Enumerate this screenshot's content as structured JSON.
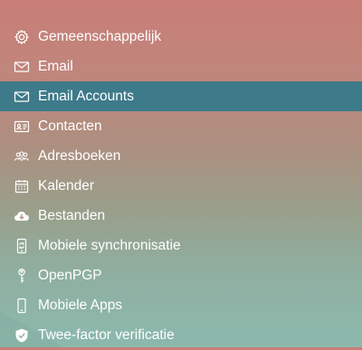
{
  "sidebar": {
    "active_index": 2,
    "items": [
      {
        "label": "Gemeenschappelijk",
        "icon": "gear-icon"
      },
      {
        "label": "Email",
        "icon": "envelope-icon"
      },
      {
        "label": "Email Accounts",
        "icon": "envelope-icon"
      },
      {
        "label": "Contacten",
        "icon": "contact-card-icon"
      },
      {
        "label": "Adresboeken",
        "icon": "people-icon"
      },
      {
        "label": "Kalender",
        "icon": "calendar-icon"
      },
      {
        "label": "Bestanden",
        "icon": "cloud-download-icon"
      },
      {
        "label": "Mobiele synchronisatie",
        "icon": "mobile-sync-icon"
      },
      {
        "label": "OpenPGP",
        "icon": "key-icon"
      },
      {
        "label": "Mobiele Apps",
        "icon": "mobile-phone-icon"
      },
      {
        "label": "Twee-factor verificatie",
        "icon": "shield-icon"
      }
    ]
  },
  "colors": {
    "active_background": "#3d7a8a",
    "text": "#ffffff"
  }
}
